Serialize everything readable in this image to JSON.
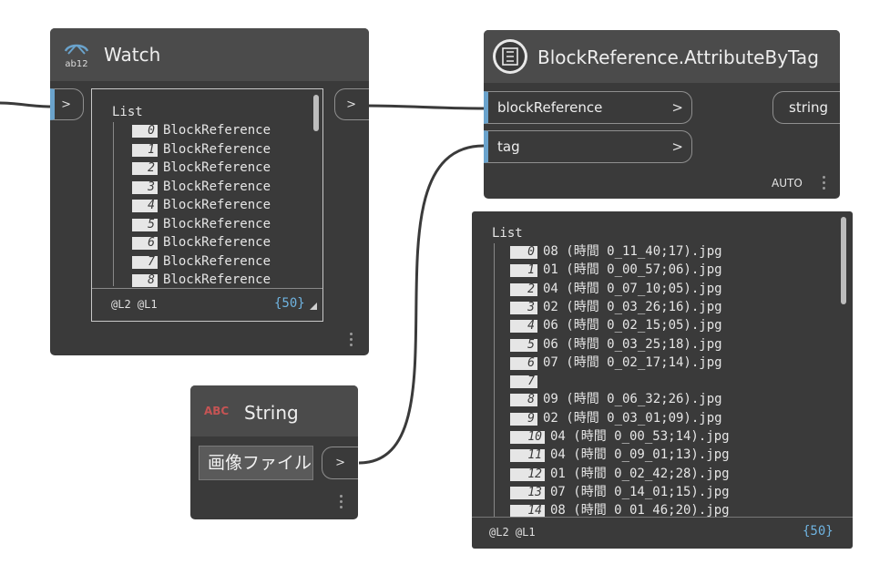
{
  "watch_node": {
    "title": "Watch",
    "icon_text": "ab12",
    "input_port": ">",
    "output_port": ">",
    "list_header": "List",
    "items": [
      {
        "index": "0",
        "value": "BlockReference"
      },
      {
        "index": "1",
        "value": "BlockReference"
      },
      {
        "index": "2",
        "value": "BlockReference"
      },
      {
        "index": "3",
        "value": "BlockReference"
      },
      {
        "index": "4",
        "value": "BlockReference"
      },
      {
        "index": "5",
        "value": "BlockReference"
      },
      {
        "index": "6",
        "value": "BlockReference"
      },
      {
        "index": "7",
        "value": "BlockReference"
      },
      {
        "index": "8",
        "value": "BlockReference"
      }
    ],
    "levels": "@L2 @L1",
    "count": "{50}"
  },
  "attr_node": {
    "title": "BlockReference.AttributeByTag",
    "inputs": [
      {
        "label": "blockReference"
      },
      {
        "label": "tag"
      }
    ],
    "output": "string",
    "lacing": "AUTO",
    "list_header": "List",
    "items": [
      {
        "index": "0",
        "value": "08 (時間 0_11_40;17).jpg"
      },
      {
        "index": "1",
        "value": "01 (時間 0_00_57;06).jpg"
      },
      {
        "index": "2",
        "value": "04 (時間 0_07_10;05).jpg"
      },
      {
        "index": "3",
        "value": "02 (時間 0_03_26;16).jpg"
      },
      {
        "index": "4",
        "value": "06 (時間 0_02_15;05).jpg"
      },
      {
        "index": "5",
        "value": "06 (時間 0_03_25;18).jpg"
      },
      {
        "index": "6",
        "value": "07 (時間 0_02_17;14).jpg"
      },
      {
        "index": "7",
        "value": ""
      },
      {
        "index": "8",
        "value": "09 (時間 0_06_32;26).jpg"
      },
      {
        "index": "9",
        "value": "02 (時間 0_03_01;09).jpg"
      },
      {
        "index": "10",
        "value": "04 (時間 0_00_53;14).jpg"
      },
      {
        "index": "11",
        "value": "04 (時間 0_09_01;13).jpg"
      },
      {
        "index": "12",
        "value": "01 (時間 0_02_42;28).jpg"
      },
      {
        "index": "13",
        "value": "07 (時間 0_14_01;15).jpg"
      },
      {
        "index": "14",
        "value": "08 (時間 0_01_46;20).jpg"
      }
    ],
    "levels": "@L2 @L1",
    "count": "{50}"
  },
  "string_node": {
    "title": "String",
    "icon_text": "ABC",
    "value": "画像ファイル",
    "output_port": ">"
  },
  "colors": {
    "canvas": "#ffffff",
    "node_body": "#3a3a3a",
    "node_header": "#4b4b4b",
    "port_accent": "#6aa3cc",
    "count_text": "#6fb3e0",
    "wire": "#3a3a3a"
  }
}
